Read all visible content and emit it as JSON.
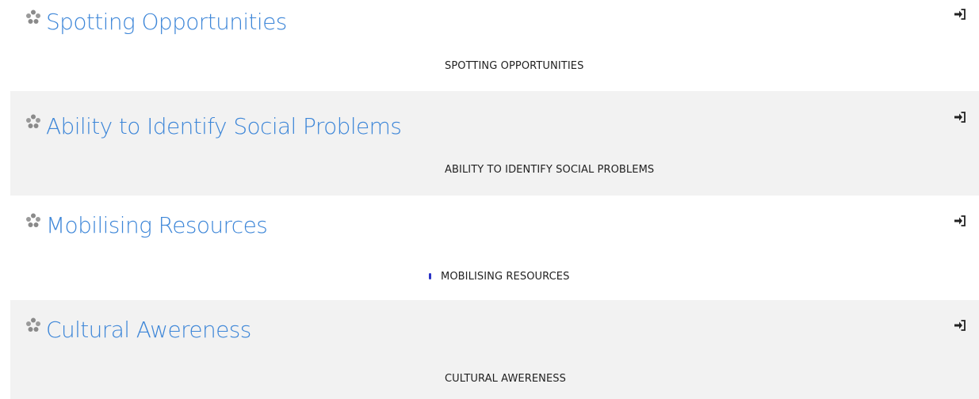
{
  "sections": [
    {
      "title": "Spotting Opportunities",
      "subtitle": "SPOTTING OPPORTUNITIES",
      "icon": "competency-icon",
      "action_icon": "enter-icon",
      "shaded": false,
      "bullet": false
    },
    {
      "title": "Ability to Identify Social Problems",
      "subtitle": "ABILITY TO IDENTIFY SOCIAL PROBLEMS",
      "icon": "competency-icon",
      "action_icon": "enter-icon",
      "shaded": true,
      "bullet": false
    },
    {
      "title": "Mobilising Resources",
      "subtitle": "MOBILISING RESOURCES",
      "icon": "competency-icon",
      "action_icon": "enter-icon",
      "shaded": false,
      "bullet": true
    },
    {
      "title": "Cultural Awereness",
      "subtitle": "CULTURAL AWERENESS",
      "icon": "competency-icon",
      "action_icon": "enter-icon",
      "shaded": true,
      "bullet": false
    }
  ],
  "colors": {
    "title": "#3d86d8",
    "subtitle": "#222222",
    "shaded_row": "#f2f2f2",
    "bullet": "#2a33c6",
    "icon": "#8a8a8a"
  }
}
